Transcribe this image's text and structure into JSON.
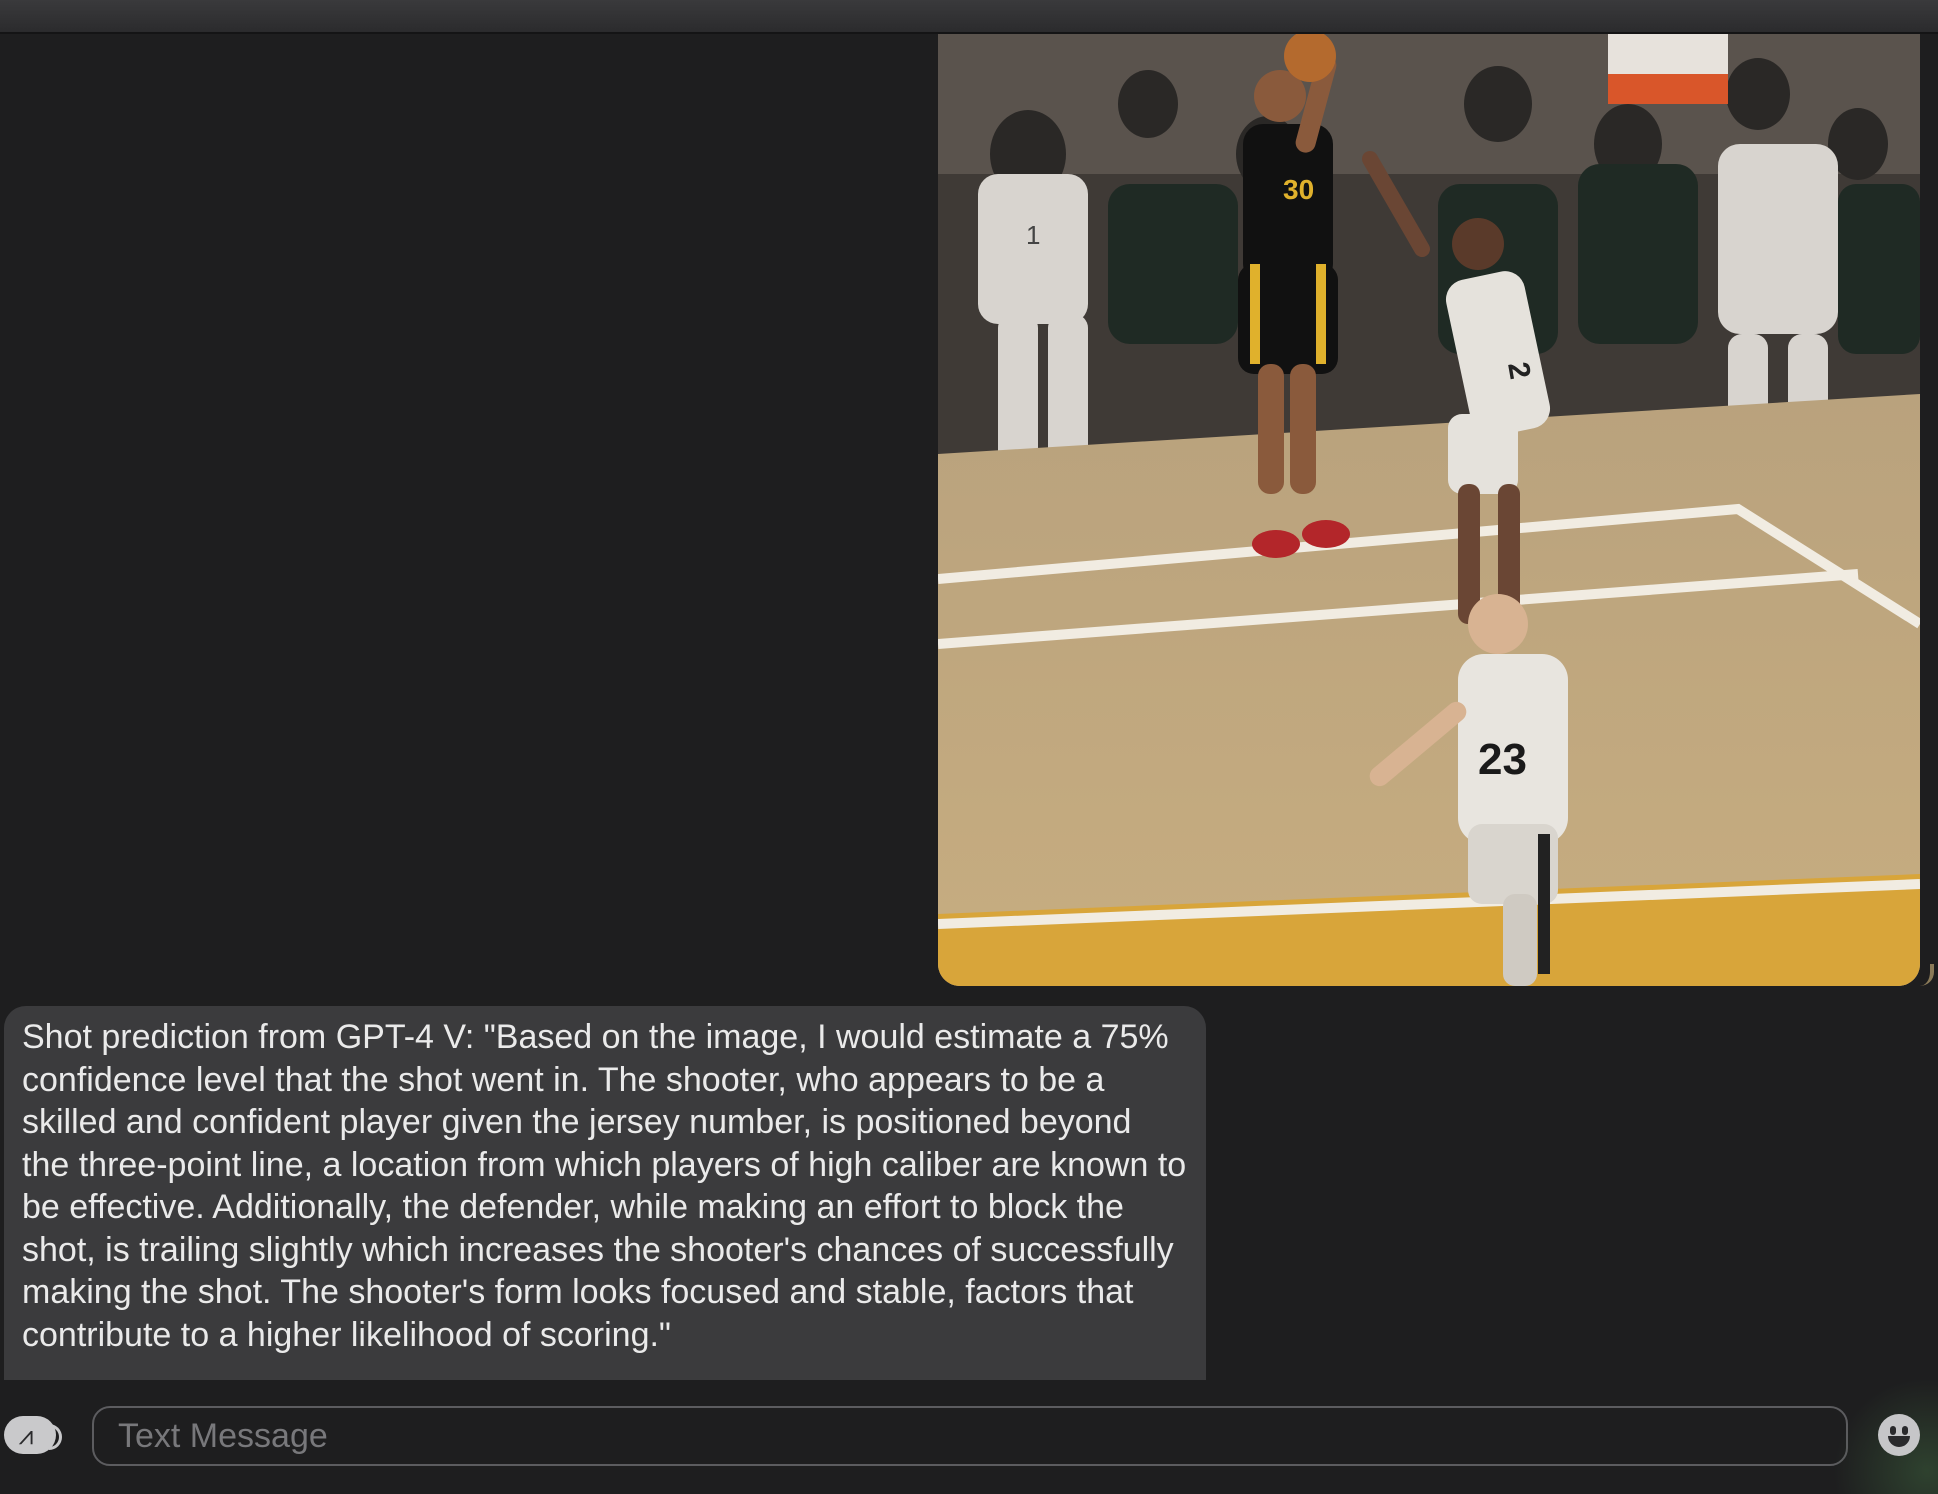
{
  "conversation": {
    "image_message": {
      "alt": "Basketball shot photo",
      "jersey_numbers": [
        "30",
        "1",
        "2",
        "23"
      ]
    },
    "text_message": {
      "text": "Shot prediction from GPT-4 V: \"Based on the image, I would estimate a 75% confidence level that the shot went in. The shooter, who appears to be a skilled and confident player given the jersey number, is positioned beyond the three-point line, a location from which players of high caliber are known to be effective. Additionally, the defender, while making an effort to block the shot, is trailing slightly which increases the shooter's chances of successfully making the shot. The shooter's form looks focused and stable, factors that contribute to a higher likelihood of scoring.\""
    }
  },
  "composer": {
    "apps_icon": "app-store-icon",
    "placeholder": "Text Message",
    "emoji_icon": "emoji-icon"
  },
  "colors": {
    "background": "#1e1e1f",
    "bubble_gray": "#3b3b3d",
    "text": "#eaeaea"
  }
}
